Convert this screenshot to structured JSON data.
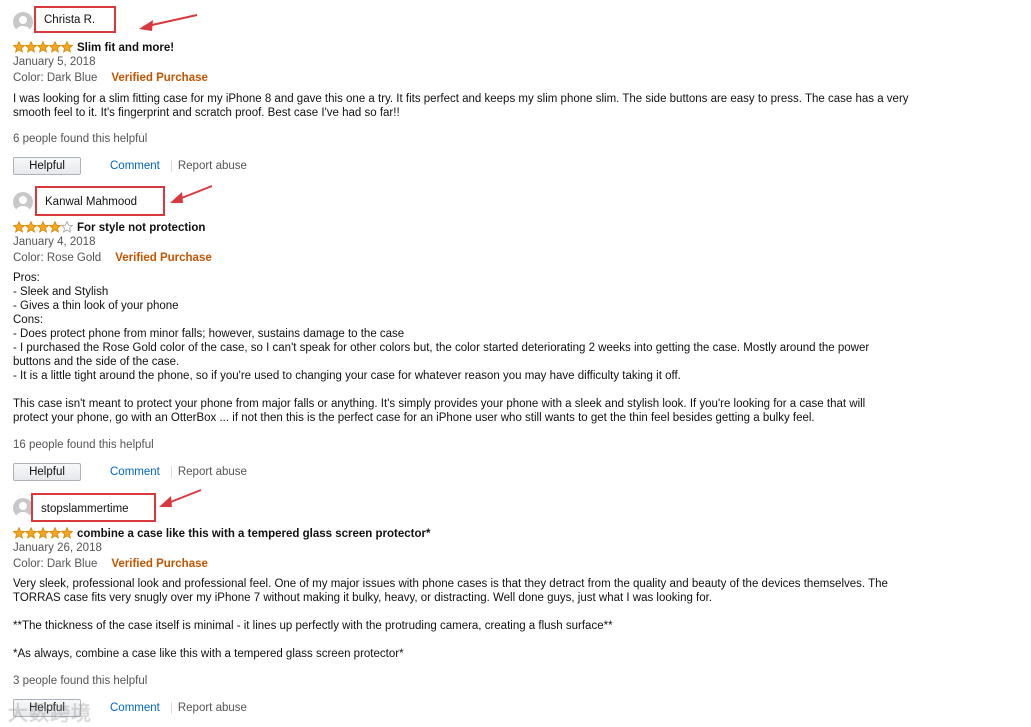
{
  "reviews": [
    {
      "reviewer": "Christa R.",
      "rating": 5,
      "max_rating": 5,
      "title": "Slim fit and more!",
      "date": "January 5, 2018",
      "color": "Color: Dark Blue",
      "verified": "Verified Purchase",
      "body": [
        "I was looking for a slim fitting case for my iPhone 8 and gave this one a try. It fits perfect and keeps my slim phone slim. The side buttons are easy to press. The case has a very",
        "smooth feel to it. It's fingerprint and scratch proof. Best case I've had so far!!"
      ],
      "helpful_count": "6 people found this helpful",
      "helpful_button": "Helpful",
      "comment": "Comment",
      "report": "Report abuse"
    },
    {
      "reviewer": "Kanwal Mahmood",
      "rating": 4,
      "max_rating": 5,
      "title": "For style not protection",
      "date": "January 4, 2018",
      "color": "Color: Rose Gold",
      "verified": "Verified Purchase",
      "body": [
        "Pros:",
        "- Sleek and Stylish",
        "- Gives a thin look of your phone",
        "Cons:",
        "- Does protect phone from minor falls; however, sustains damage to the case",
        "- I purchased the Rose Gold color of the case, so I can't speak for other colors but, the color started deteriorating 2 weeks into getting the case. Mostly around the power",
        "buttons and the side of the case.",
        "- It is a little tight around the phone, so if you're used to changing your case for whatever reason you may have difficulty taking it off.",
        "",
        "This case isn't meant to protect your phone from major falls or anything. It's simply provides your phone with a sleek and stylish look. If you're looking for a case that will",
        "protect your phone, go with an OtterBox ... if not then this is the perfect case for an iPhone user who still wants to get the thin feel besides getting a bulky feel."
      ],
      "helpful_count": "16 people found this helpful",
      "helpful_button": "Helpful",
      "comment": "Comment",
      "report": "Report abuse"
    },
    {
      "reviewer": "stopslammertime",
      "rating": 5,
      "max_rating": 5,
      "title": "combine a case like this with a tempered glass screen protector*",
      "date": "January 26, 2018",
      "color": "Color: Dark Blue",
      "verified": "Verified Purchase",
      "body": [
        "Very sleek, professional look and professional feel. One of my major issues with phone cases is that they detract from the quality and beauty of the devices themselves. The",
        "TORRAS case fits very snugly over my iPhone 7 without making it bulky, heavy, or distracting. Well done guys, just what I was looking for.",
        "",
        "**The thickness of the case itself is minimal - it lines up perfectly with the protruding camera, creating a flush surface**",
        "",
        "*As always, combine a case like this with a tempered glass screen protector*"
      ],
      "helpful_count": "3 people found this helpful",
      "helpful_button": "Helpful",
      "comment": "Comment",
      "report": "Report abuse"
    }
  ],
  "watermark": "大数跨境",
  "colors": {
    "highlight_red": "#d9393c",
    "star_gold": "#f5a623",
    "verified_orange": "#c45500",
    "link_blue": "#0066c0"
  }
}
